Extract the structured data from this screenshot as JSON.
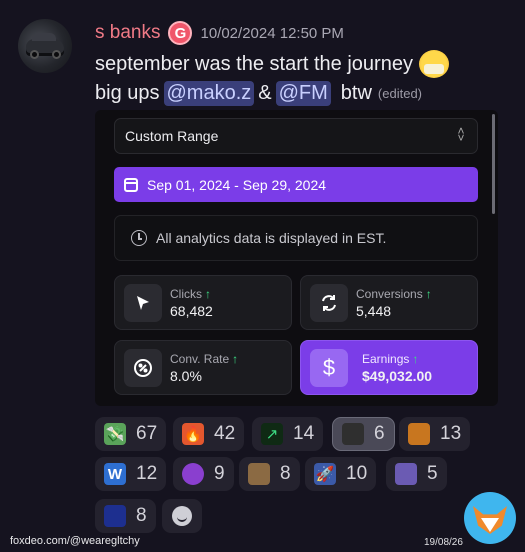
{
  "message": {
    "username": "s banks",
    "timestamp": "10/02/2024 12:50 PM",
    "line1": "september was the start the journey",
    "line2_prefix": "big ups",
    "mention1": "@mako.z",
    "ampersand": "&",
    "mention2": "@FM",
    "line2_suffix": "btw",
    "edited": "(edited)",
    "username_color": "#f07a86"
  },
  "embed": {
    "range_label": "Custom Range",
    "date_range": "Sep 01, 2024 - Sep 29, 2024",
    "timezone_note": "All analytics data is displayed in EST.",
    "accent_color": "#7b3de8",
    "stats": [
      {
        "label": "Clicks",
        "value": "68,482",
        "icon": "cursor-icon"
      },
      {
        "label": "Conversions",
        "value": "5,448",
        "icon": "refresh-icon"
      },
      {
        "label": "Conv. Rate",
        "value": "8.0%",
        "icon": "percent-cycle-icon"
      },
      {
        "label": "Earnings",
        "value": "$49,032.00",
        "icon": "dollar-icon"
      }
    ]
  },
  "reactions": [
    {
      "emoji": "money-wings",
      "count": "67"
    },
    {
      "emoji": "fire",
      "count": "42"
    },
    {
      "emoji": "chart-up",
      "count": "14"
    },
    {
      "emoji": "face-photo",
      "count": "6",
      "selected": true
    },
    {
      "emoji": "tornado-cup",
      "count": "13"
    },
    {
      "emoji": "w-letter",
      "count": "12"
    },
    {
      "emoji": "smiling-devil",
      "count": "9"
    },
    {
      "emoji": "goat",
      "count": "8"
    },
    {
      "emoji": "rocket",
      "count": "10"
    },
    {
      "emoji": "wizard-ghost",
      "count": "5"
    },
    {
      "emoji": "blue-figure",
      "count": "8"
    }
  ],
  "watermark": {
    "handle": "foxdeo.com/@wearegltchy",
    "date": "19/08/26"
  }
}
